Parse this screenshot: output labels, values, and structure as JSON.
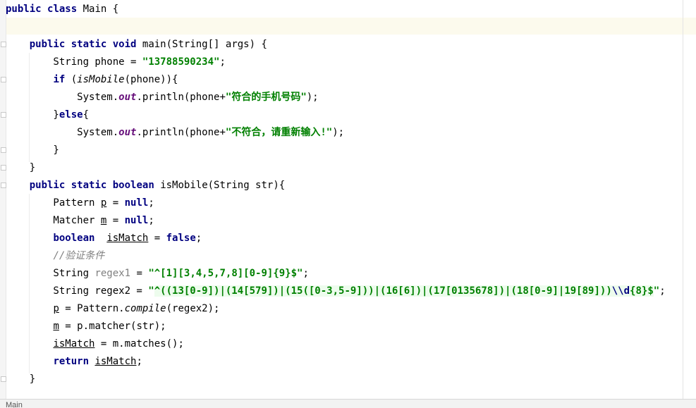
{
  "editor": {
    "lines": [
      {
        "tokens": [
          {
            "t": "public",
            "c": "kw"
          },
          {
            "t": " "
          },
          {
            "t": "class",
            "c": "kw"
          },
          {
            "t": " Main {"
          }
        ]
      },
      {
        "tokens": []
      },
      {
        "tokens": [
          {
            "t": "    "
          },
          {
            "t": "public",
            "c": "kw"
          },
          {
            "t": " "
          },
          {
            "t": "static",
            "c": "kw"
          },
          {
            "t": " "
          },
          {
            "t": "void",
            "c": "kw"
          },
          {
            "t": " main(String[] args) {"
          }
        ]
      },
      {
        "tokens": [
          {
            "t": "        String phone = "
          },
          {
            "t": "\"13788590234\"",
            "c": "str"
          },
          {
            "t": ";"
          }
        ]
      },
      {
        "tokens": [
          {
            "t": "        "
          },
          {
            "t": "if",
            "c": "kw"
          },
          {
            "t": " ("
          },
          {
            "t": "isMobile",
            "c": "it"
          },
          {
            "t": "(phone)){"
          }
        ]
      },
      {
        "tokens": [
          {
            "t": "            System."
          },
          {
            "t": "out",
            "c": "field"
          },
          {
            "t": ".println(phone+"
          },
          {
            "t": "\"符合的手机号码\"",
            "c": "str"
          },
          {
            "t": ");"
          }
        ]
      },
      {
        "tokens": [
          {
            "t": "        }"
          },
          {
            "t": "else",
            "c": "kw"
          },
          {
            "t": "{"
          }
        ]
      },
      {
        "tokens": [
          {
            "t": "            System."
          },
          {
            "t": "out",
            "c": "field"
          },
          {
            "t": ".println(phone+"
          },
          {
            "t": "\"不符合，请重新输入!\"",
            "c": "str"
          },
          {
            "t": ");"
          }
        ]
      },
      {
        "tokens": [
          {
            "t": "        }"
          }
        ]
      },
      {
        "tokens": [
          {
            "t": "    }"
          }
        ]
      },
      {
        "tokens": [
          {
            "t": "    "
          },
          {
            "t": "public",
            "c": "kw"
          },
          {
            "t": " "
          },
          {
            "t": "static",
            "c": "kw"
          },
          {
            "t": " "
          },
          {
            "t": "boolean",
            "c": "kw"
          },
          {
            "t": " isMobile(String str){"
          }
        ]
      },
      {
        "tokens": [
          {
            "t": "        Pattern "
          },
          {
            "t": "p",
            "c": "ul"
          },
          {
            "t": " = "
          },
          {
            "t": "null",
            "c": "kw"
          },
          {
            "t": ";"
          }
        ]
      },
      {
        "tokens": [
          {
            "t": "        Matcher "
          },
          {
            "t": "m",
            "c": "ul"
          },
          {
            "t": " = "
          },
          {
            "t": "null",
            "c": "kw"
          },
          {
            "t": ";"
          }
        ]
      },
      {
        "tokens": [
          {
            "t": "        "
          },
          {
            "t": "boolean",
            "c": "kw"
          },
          {
            "t": "  "
          },
          {
            "t": "isMatch",
            "c": "ul"
          },
          {
            "t": " = "
          },
          {
            "t": "false",
            "c": "kw"
          },
          {
            "t": ";"
          }
        ]
      },
      {
        "tokens": [
          {
            "t": "        "
          },
          {
            "t": "//验证条件",
            "c": "cmt"
          }
        ]
      },
      {
        "tokens": [
          {
            "t": "        String "
          },
          {
            "t": "regex1",
            "c": "unused"
          },
          {
            "t": " = "
          },
          {
            "t": "\"^[1][3,4,5,7,8][0-9]{9}$\"",
            "c": "str"
          },
          {
            "t": ";"
          }
        ]
      },
      {
        "tokens": [
          {
            "t": "        String regex2 = "
          },
          {
            "t": "\"",
            "c": "str"
          },
          {
            "t": "^((13[0-9])|(14[579])|(15([0-3,5-9]))|(16[6])|(17[0135678])|(18[0-9]|19[89]))",
            "c": "str rx"
          },
          {
            "t": "\\\\d",
            "c": "esc rx"
          },
          {
            "t": "{8}$",
            "c": "str rx"
          },
          {
            "t": "\"",
            "c": "str"
          },
          {
            "t": ";"
          }
        ]
      },
      {
        "tokens": [
          {
            "t": "        "
          },
          {
            "t": "p",
            "c": "ul"
          },
          {
            "t": " = Pattern."
          },
          {
            "t": "compile",
            "c": "it"
          },
          {
            "t": "(regex2);"
          }
        ]
      },
      {
        "tokens": [
          {
            "t": "        "
          },
          {
            "t": "m",
            "c": "ul"
          },
          {
            "t": " = p.matcher(str);"
          }
        ]
      },
      {
        "tokens": [
          {
            "t": "        "
          },
          {
            "t": "isMatch",
            "c": "ul"
          },
          {
            "t": " = m.matches();"
          }
        ]
      },
      {
        "tokens": [
          {
            "t": "        "
          },
          {
            "t": "return",
            "c": "kw"
          },
          {
            "t": " "
          },
          {
            "t": "isMatch",
            "c": "ul"
          },
          {
            "t": ";"
          }
        ]
      },
      {
        "tokens": [
          {
            "t": "    }"
          }
        ]
      }
    ]
  },
  "status_bar": {
    "text": "Main"
  }
}
